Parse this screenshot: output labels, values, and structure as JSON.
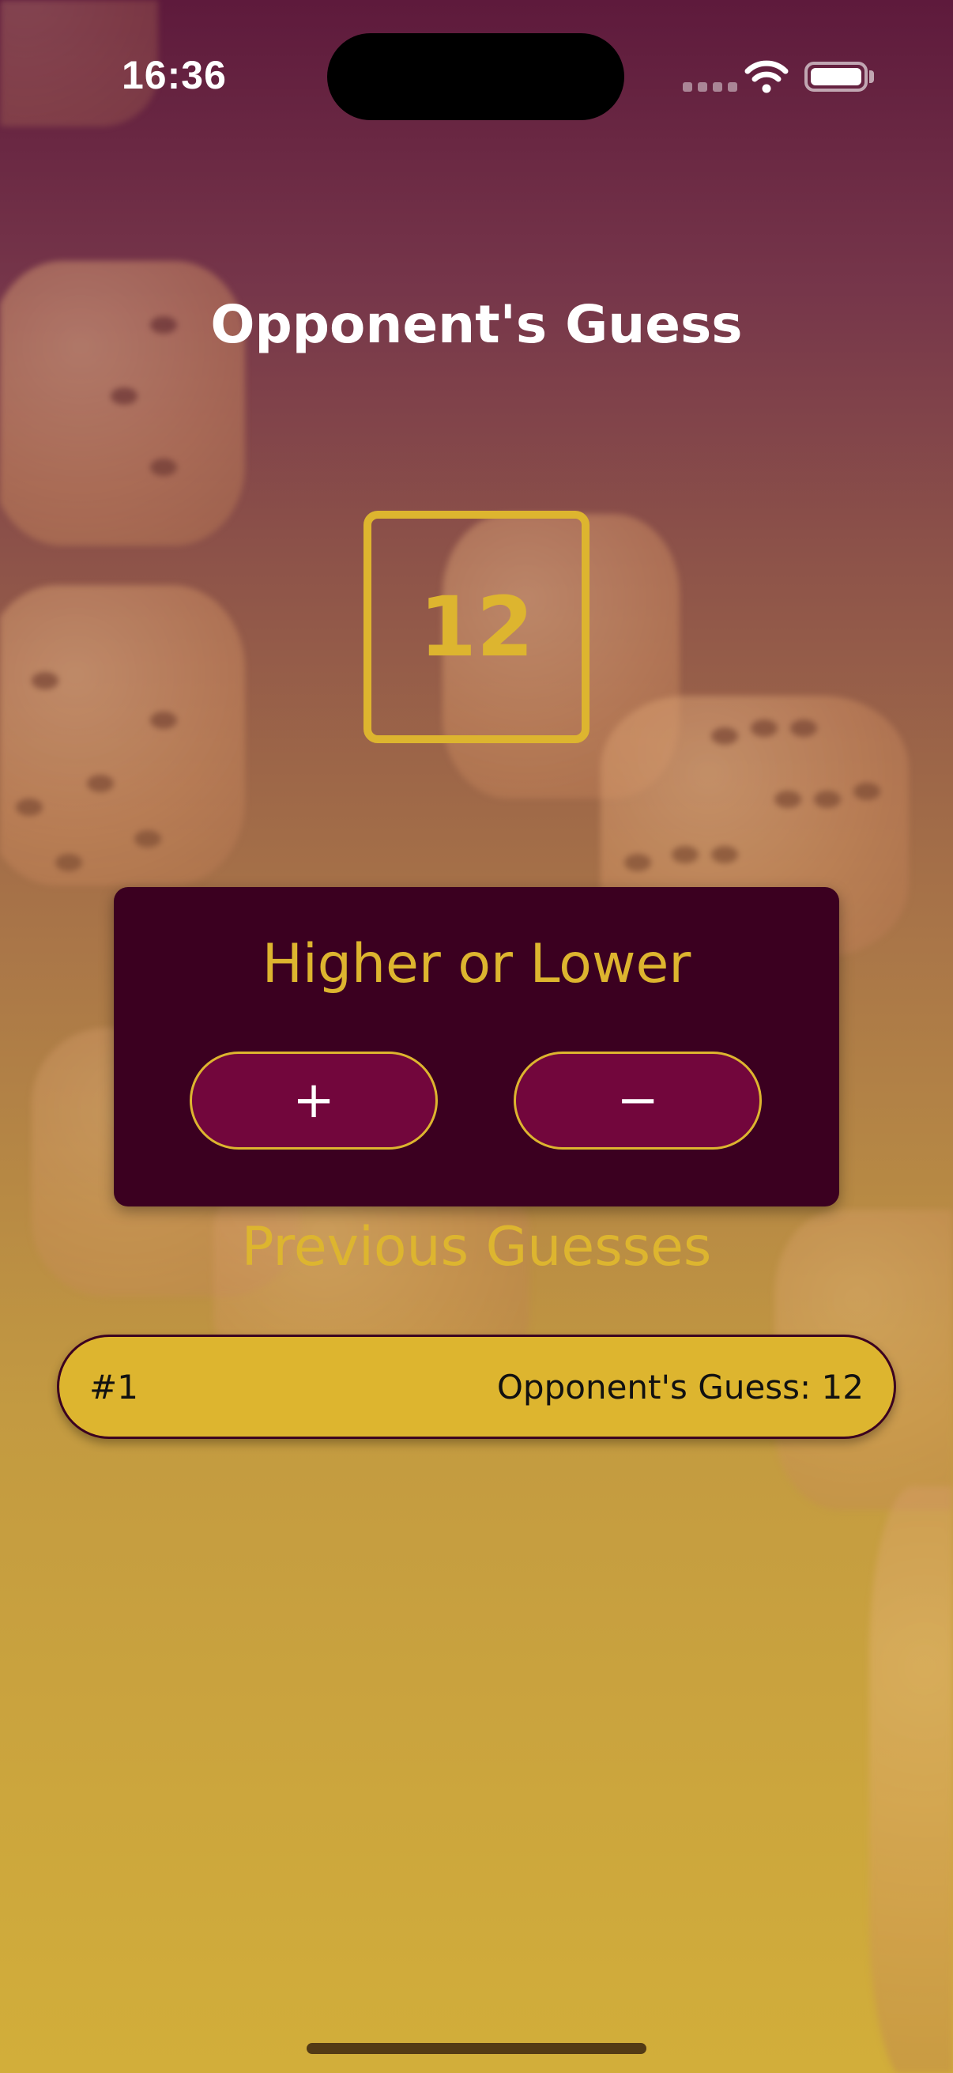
{
  "status_bar": {
    "time": "16:36",
    "icons": [
      "cellular-signal-icon",
      "wifi-icon",
      "battery-icon"
    ]
  },
  "screen": {
    "title": "Opponent's Guess",
    "current_guess": "12"
  },
  "controls": {
    "title": "Higher or Lower",
    "higher_label": "+",
    "lower_label": "−"
  },
  "history": {
    "title": "Previous Guesses",
    "items": [
      {
        "round": "#1",
        "text": "Opponent's Guess: 12"
      }
    ]
  },
  "colors": {
    "accent": "#ddb52f",
    "card": "#3b0020",
    "button": "#72063c",
    "gradient_top": "#5e1a3c",
    "gradient_bottom": "#d2ae3a"
  }
}
